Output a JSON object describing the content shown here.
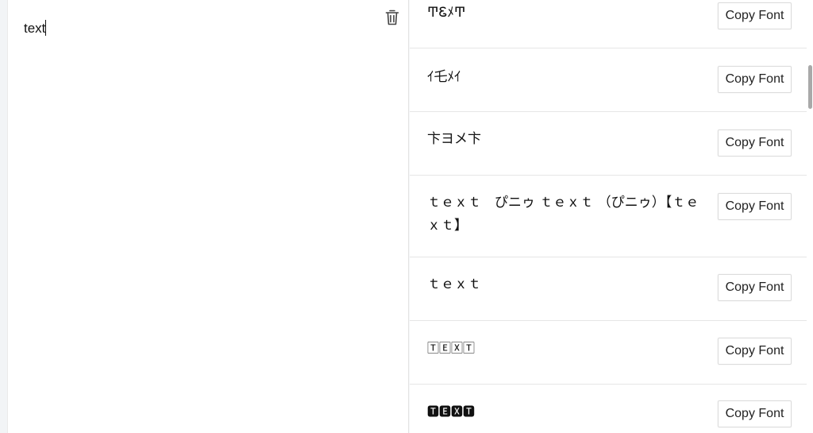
{
  "editor": {
    "text": "text"
  },
  "results": {
    "items": [
      {
        "preview": "ͲᏋﾒͲ",
        "button_label": "Copy Font"
      },
      {
        "preview": "ｲ乇ﾒｲ",
        "button_label": "Copy Font"
      },
      {
        "preview": "卞ヨメ卞",
        "button_label": "Copy Font"
      },
      {
        "preview": "ｔｅｘｔ　ぴニゥ ｔｅｘｔ （ぴニゥ）【ｔｅｘｔ】",
        "button_label": "Copy Font"
      },
      {
        "preview": "ｔｅｘｔ",
        "button_label": "Copy Font"
      },
      {
        "preview": "🅃🄴🅇🅃",
        "button_label": "Copy Font"
      },
      {
        "preview": "🆃🅴🆇🆃",
        "button_label": "Copy Font"
      }
    ]
  },
  "icons": {
    "delete": "trash-icon"
  }
}
